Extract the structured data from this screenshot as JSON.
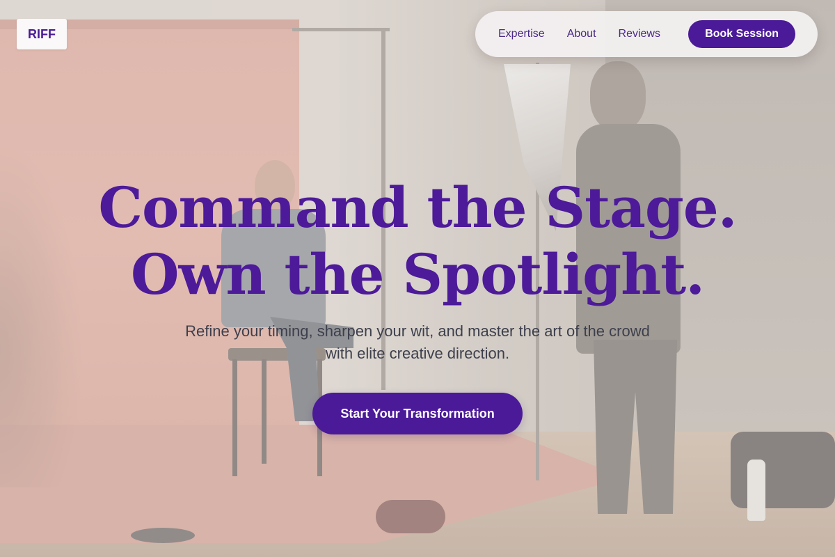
{
  "brand": {
    "logo_text": "RIFF"
  },
  "nav": {
    "links": [
      "Expertise",
      "About",
      "Reviews"
    ],
    "cta_label": "Book Session"
  },
  "hero": {
    "title_line1": "Command the Stage.",
    "title_line2": "Own the Spotlight.",
    "subtitle": "Refine your timing, sharpen your wit, and master the art of the crowd with elite creative direction.",
    "cta_label": "Start Your Transformation"
  },
  "colors": {
    "accent": "#4b1a98",
    "nav_text": "#4a2a86",
    "body_text": "#3d3f4c"
  }
}
